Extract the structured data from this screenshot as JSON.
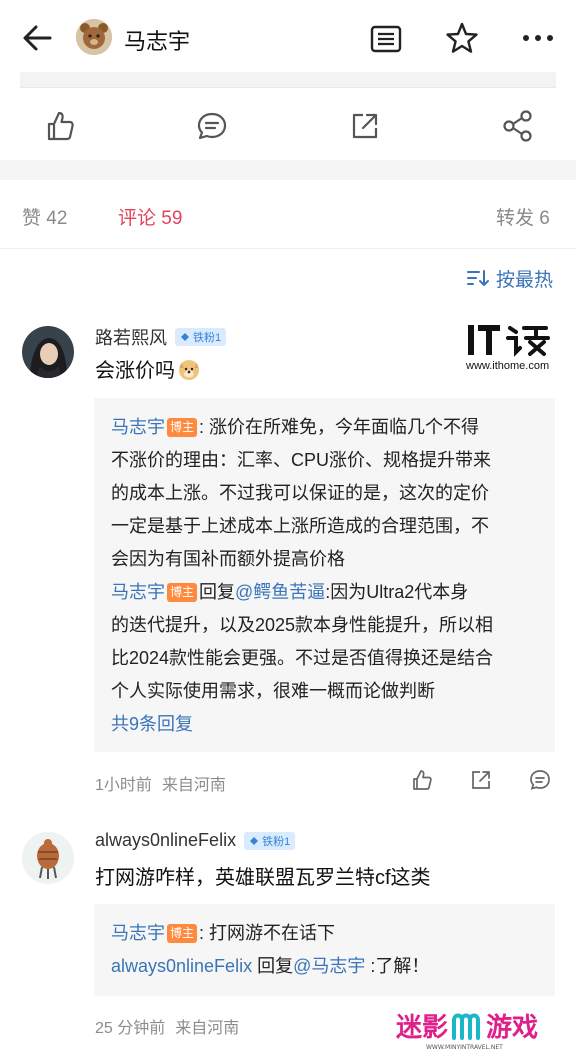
{
  "header": {
    "author_name": "马志宇",
    "icons": [
      "back-arrow-icon",
      "avatar-bear",
      "document-icon",
      "star-icon",
      "more-icon"
    ]
  },
  "actions": {
    "icons": [
      "thumbs-up-icon",
      "comment-icon",
      "repost-icon",
      "share-icon"
    ]
  },
  "stats": {
    "likes": "赞 42",
    "comments": "评论 59",
    "reposts": "转发 6"
  },
  "sort": {
    "label": "按最热"
  },
  "comments": [
    {
      "username": "路若熙风",
      "fan_badge": "铁粉1",
      "text": "会涨价吗",
      "emoji": "doge",
      "replies": [
        {
          "author": "马志宇",
          "tag": "博主",
          "lines": [
            ": 涨价在所难免，今年面临几个不得",
            "不涨价的理由：汇率、CPU涨价、规格提升带来",
            "的成本上涨。不过我可以保证的是，这次的定价",
            "一定是基于上述成本上涨所造成的合理范围，不",
            "会因为有国补而额外提高价格"
          ]
        },
        {
          "author": "马志宇",
          "tag": "博主",
          "reply_word": "回复",
          "target": "@鳄鱼苦逼",
          "lines": [
            ":因为Ultra2代本身",
            "的迭代提升，以及2025款本身性能提升，所以相",
            "比2024款性能会更强。不过是否值得换还是结合",
            "个人实际使用需求，很难一概而论做判断"
          ]
        }
      ],
      "more_replies": "共9条回复",
      "time": "1小时前",
      "location": "来自河南"
    },
    {
      "username": "always0nlineFelix",
      "fan_badge": "铁粉1",
      "text": "打网游咋样，英雄联盟瓦罗兰特cf这类",
      "replies": [
        {
          "author": "马志宇",
          "tag": "博主",
          "lines": [
            ": 打网游不在话下"
          ]
        },
        {
          "author": "always0nlineFelix",
          "reply_word": "回复",
          "target": "@马志宇",
          "lines": [
            ":了解！"
          ]
        }
      ],
      "time": "25 分钟前",
      "location": "来自河南"
    }
  ],
  "watermarks": {
    "ithome_logo": "IT之家",
    "ithome_url": "www.ithome.com",
    "minying_logo": "迷影游戏",
    "minying_url": "WWW.MINYINTRAVEL.NET"
  },
  "colors": {
    "accent_red": "#e0445a",
    "link_blue": "#3a74b8",
    "host_tag_orange": "#ff8a3d",
    "fan_badge_bg": "#d9ebff"
  }
}
